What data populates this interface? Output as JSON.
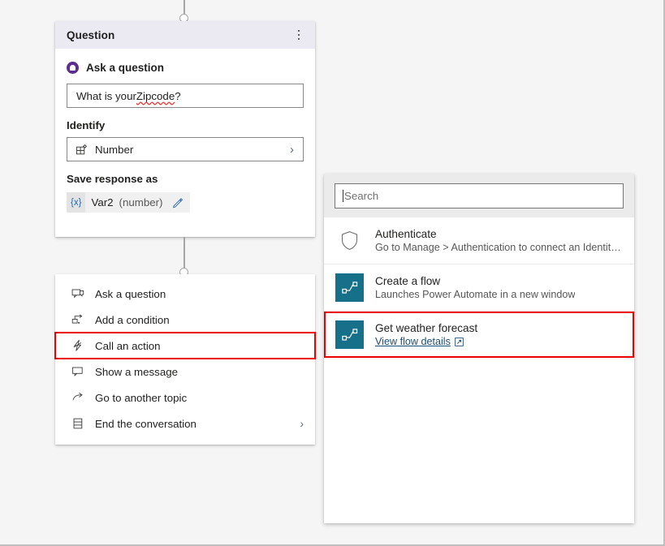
{
  "question_card": {
    "header_title": "Question",
    "menu_icon": "kebab-more-icon",
    "ask_label": "Ask a question",
    "ask_radio_icon": "question-filled-icon",
    "question_text_before": "What is your ",
    "question_text_misspelled": "Zipcode",
    "question_text_after": "?",
    "question_full": "What is your Zipcode?",
    "identify_label": "Identify",
    "identify_value": "Number",
    "identify_icon": "entity-grid-icon",
    "identify_chevron": "chevron-right-icon",
    "save_label": "Save response as",
    "variable_tag": "{x}",
    "variable_name": "Var2",
    "variable_type": "(number)",
    "edit_icon": "pencil-edit-icon"
  },
  "action_menu": {
    "items": [
      {
        "label": "Ask a question",
        "icon": "ask-question-icon",
        "chevron": "",
        "highlighted": false
      },
      {
        "label": "Add a condition",
        "icon": "branch-condition-icon",
        "chevron": "",
        "highlighted": false
      },
      {
        "label": "Call an action",
        "icon": "lightning-bolt-icon",
        "chevron": "",
        "highlighted": true
      },
      {
        "label": "Show a message",
        "icon": "message-bubble-icon",
        "chevron": "",
        "highlighted": false
      },
      {
        "label": "Go to another topic",
        "icon": "redirect-arrow-icon",
        "chevron": "",
        "highlighted": false
      },
      {
        "label": "End the conversation",
        "icon": "end-conversation-icon",
        "chevron": "›",
        "highlighted": false
      }
    ]
  },
  "flow_panel": {
    "search_placeholder": "Search",
    "search_value": "",
    "items": [
      {
        "title": "Authenticate",
        "subtitle": "Go to Manage > Authentication to connect an Identity...",
        "icon": "shield-icon",
        "link": "",
        "link_icon": "",
        "highlighted": false
      },
      {
        "title": "Create a flow",
        "subtitle": "Launches Power Automate in a new window",
        "icon": "power-automate-flow-icon",
        "link": "",
        "link_icon": "",
        "highlighted": false
      },
      {
        "title": "Get weather forecast",
        "subtitle": "",
        "icon": "power-automate-flow-icon",
        "link": "View flow details",
        "link_icon": "open-in-new-window-icon",
        "highlighted": true
      }
    ]
  },
  "colors": {
    "accent_purple": "#5b2d90",
    "flow_teal": "#16708a",
    "highlight_red": "#ee0000",
    "header_lavender": "#ebe9f2",
    "link_blue": "#1c4f78",
    "canvas_gray": "#f5f5f5"
  }
}
